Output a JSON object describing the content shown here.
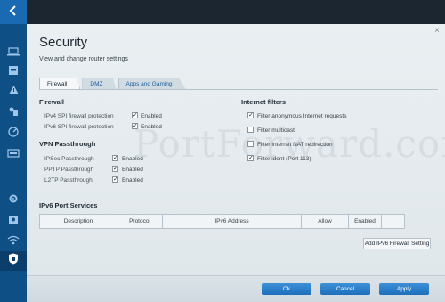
{
  "page": {
    "title": "Security",
    "subtitle": "View and change router settings",
    "close": "×"
  },
  "tabs": [
    {
      "label": "Firewall"
    },
    {
      "label": "DMZ"
    },
    {
      "label": "Apps and Gaming"
    }
  ],
  "firewall": {
    "title": "Firewall",
    "rows": [
      {
        "label": "IPv4 SPI firewall protection",
        "checked": true,
        "state": "Enabled"
      },
      {
        "label": "IPv6 SPI firewall protection",
        "checked": true,
        "state": "Enabled"
      }
    ]
  },
  "vpn": {
    "title": "VPN Passthrough",
    "rows": [
      {
        "label": "IPSec Passthrough",
        "checked": true,
        "state": "Enabled"
      },
      {
        "label": "PPTP Passthrough",
        "checked": true,
        "state": "Enabled"
      },
      {
        "label": "L2TP Passthrough",
        "checked": true,
        "state": "Enabled"
      }
    ]
  },
  "internet_filters": {
    "title": "Internet filters",
    "items": [
      {
        "label": "Filter anonymous Internet requests",
        "checked": true
      },
      {
        "label": "Filter multicast",
        "checked": false
      },
      {
        "label": "Filter Internet NAT redirection",
        "checked": false
      },
      {
        "label": "Filter ident (Port 113)",
        "checked": true
      }
    ]
  },
  "ipv6": {
    "title": "IPv6 Port Services",
    "columns": [
      "Description",
      "Protocol",
      "IPv6 Address",
      "Allow",
      "Enabled"
    ],
    "add_button": "Add IPv6 Firewall Setting"
  },
  "footer": {
    "ok": "Ok",
    "cancel": "Cancel",
    "apply": "Apply"
  },
  "watermark": "PortForward.com",
  "nav": [
    "back",
    "devices",
    "storage",
    "alert",
    "parental",
    "speed",
    "media",
    "settings",
    "diagnostics",
    "wifi",
    "security"
  ]
}
